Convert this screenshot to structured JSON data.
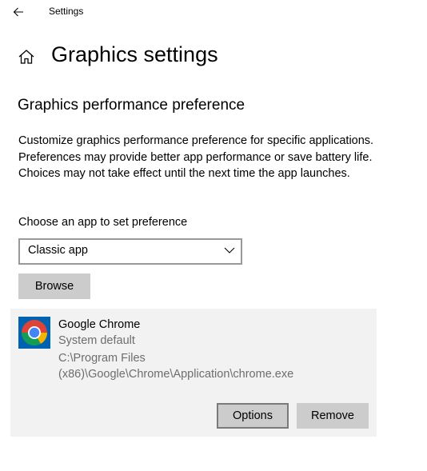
{
  "window": {
    "title": "Settings",
    "back_icon": "back-arrow-icon"
  },
  "header": {
    "home_icon": "home-icon",
    "title": "Graphics settings"
  },
  "section": {
    "title": "Graphics performance preference",
    "description": "Customize graphics performance preference for specific applications. Preferences may provide better app performance or save battery life. Choices may not take effect until the next time the app launches."
  },
  "app_chooser": {
    "label": "Choose an app to set preference",
    "selected": "Classic app",
    "chevron_icon": "chevron-down-icon",
    "browse_label": "Browse"
  },
  "apps": [
    {
      "name": "Google Chrome",
      "preference": "System default",
      "path": "C:\\Program Files (x86)\\Google\\Chrome\\Application\\chrome.exe",
      "icon": "chrome-icon",
      "options_label": "Options",
      "remove_label": "Remove"
    }
  ],
  "colors": {
    "accent_tile": "#0063b1",
    "card_background": "#f2f2f2",
    "button_background": "#cccccc",
    "secondary_text": "#6d6d6d"
  }
}
